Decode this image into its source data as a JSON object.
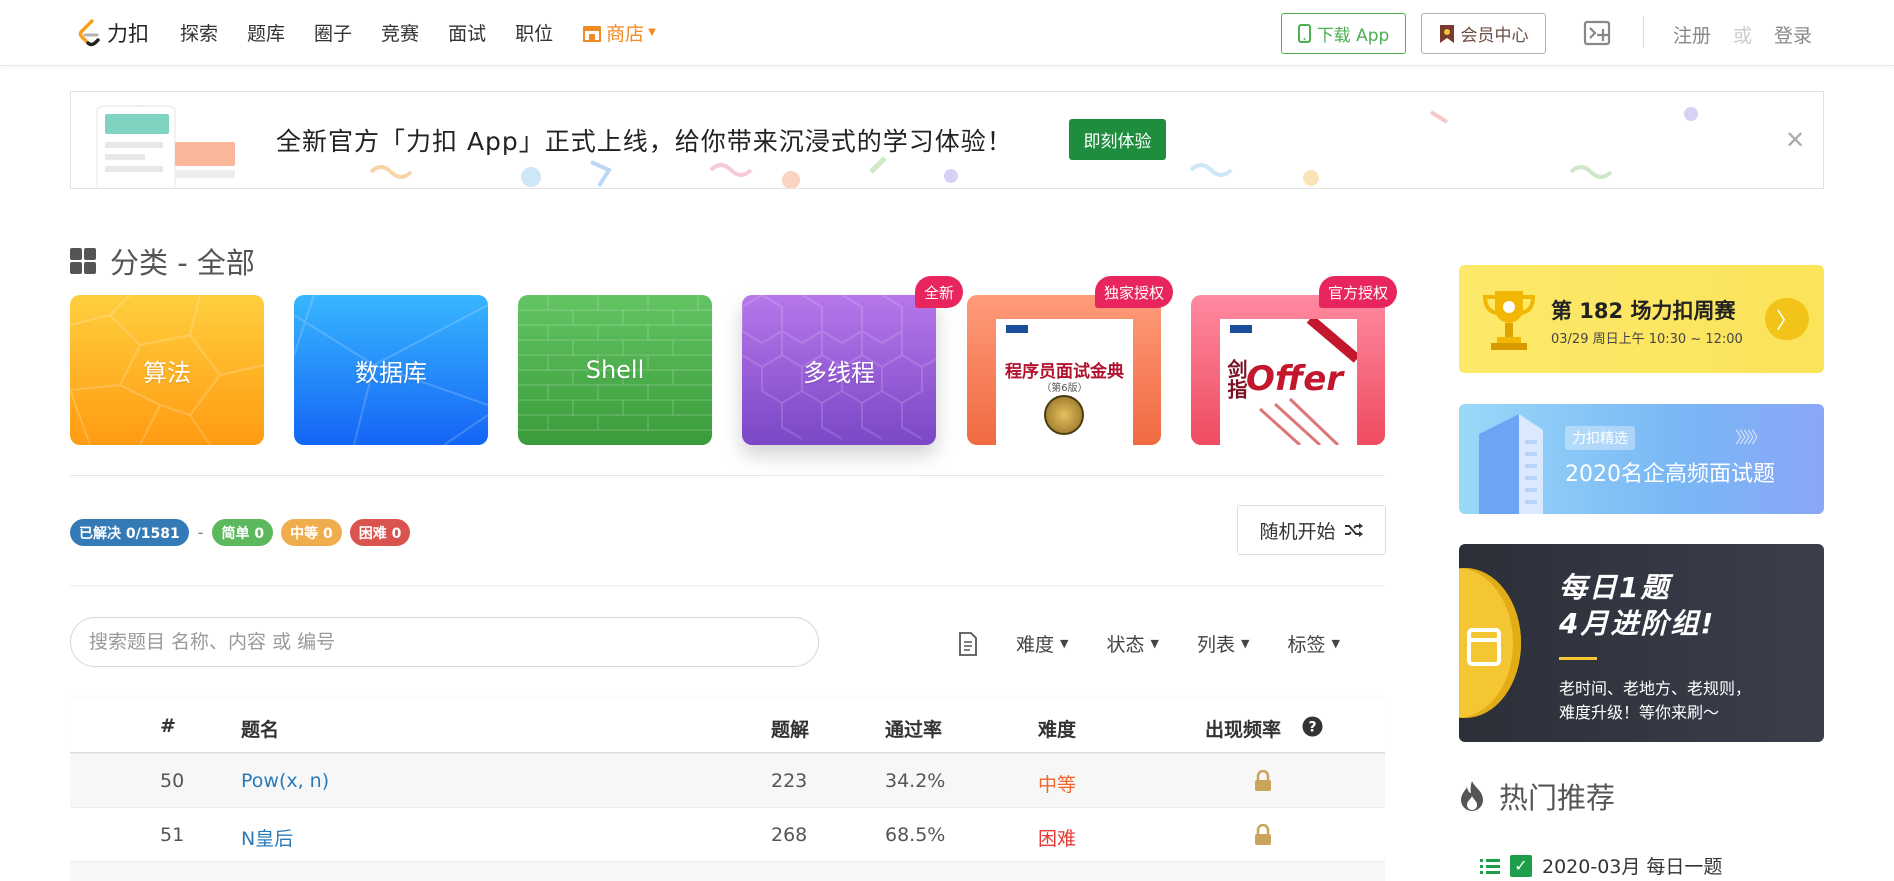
{
  "nav": {
    "logo_text": "力扣",
    "links": [
      "探索",
      "题库",
      "圈子",
      "竞赛",
      "面试",
      "职位"
    ],
    "store_label": "商店",
    "download_app": "下载 App",
    "vip_center": "会员中心",
    "register": "注册",
    "or": "或",
    "login": "登录"
  },
  "banner": {
    "text": "全新官方「力扣 App」正式上线，给你带来沉浸式的学习体验！",
    "cta": "即刻体验",
    "close": "✕"
  },
  "category": {
    "title": "分类 - 全部",
    "cards": [
      {
        "label": "算法"
      },
      {
        "label": "数据库"
      },
      {
        "label": "Shell"
      },
      {
        "label": "多线程",
        "badge": "全新"
      },
      {
        "label": "",
        "badge": "独家授权",
        "book_title": "程序员面试金典",
        "book_sub": "（第6版）"
      },
      {
        "label": "",
        "badge": "官方授权",
        "book_title": "剑指Offer",
        "jian": "剑指",
        "offer": "Offer"
      }
    ]
  },
  "stats": {
    "solved": "已解决 0/1581",
    "dash": "-",
    "easy": "简单 0",
    "medium": "中等 0",
    "hard": "困难 0",
    "random": "随机开始"
  },
  "search": {
    "placeholder": "搜索题目 名称、内容 或 编号"
  },
  "filters": [
    "难度",
    "状态",
    "列表",
    "标签"
  ],
  "table": {
    "headers": {
      "num": "#",
      "title": "题名",
      "solution": "题解",
      "rate": "通过率",
      "difficulty": "难度",
      "frequency": "出现频率"
    },
    "rows": [
      {
        "num": "50",
        "title": "Pow(x, n)",
        "solution": "223",
        "rate": "34.2%",
        "difficulty": "中等"
      },
      {
        "num": "51",
        "title": "N皇后",
        "solution": "268",
        "rate": "68.5%",
        "difficulty": "困难"
      }
    ]
  },
  "sidebar": {
    "contest": {
      "title": "第 182 场力扣周赛",
      "time": "03/29 周日上午 10:30 ~ 12:00",
      "arrow": "〉"
    },
    "featured": {
      "tag": "力扣精选",
      "title": "2020名企高频面试题"
    },
    "daily": {
      "line1": "每日1题",
      "line2": "4月进阶组!",
      "sub1": "老时间、老地方、老规则，",
      "sub2": "难度升级！等你来刷～"
    },
    "hot": {
      "title": "热门推荐",
      "item": "2020-03月 每日一题"
    }
  },
  "colors": {
    "accent_green": "#1e8e3e",
    "link_blue": "#2a7ab8",
    "medium": "#f0662d",
    "hard": "#e53935",
    "store_orange": "#f28b23"
  }
}
